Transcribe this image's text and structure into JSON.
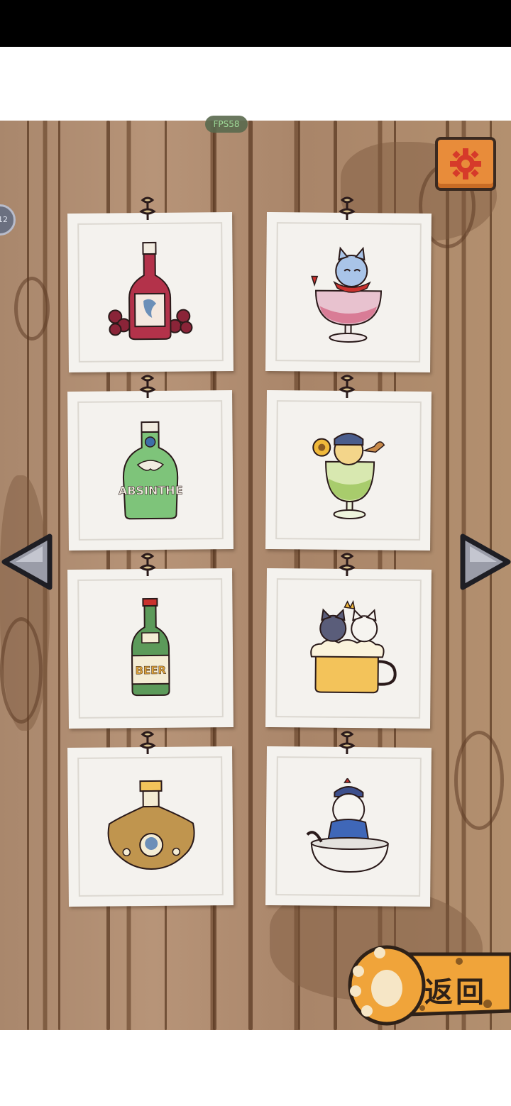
{
  "hud": {
    "fps_label": "FPS58",
    "side_badge": "12"
  },
  "settings": {
    "icon": "gear-icon",
    "accent": "#e88c3a"
  },
  "collection": {
    "items": [
      {
        "name": "red-wine-bottle",
        "icon": "wine-bottle-icon"
      },
      {
        "name": "cat-in-wine-glass",
        "icon": "wine-glass-cat-icon"
      },
      {
        "name": "absinthe-bottle",
        "icon": "absinthe-bottle-icon",
        "label": "ABSINTHE"
      },
      {
        "name": "cat-in-absinthe-glass",
        "icon": "absinthe-glass-cat-icon"
      },
      {
        "name": "beer-bottle",
        "icon": "beer-bottle-icon",
        "label": "BEER"
      },
      {
        "name": "cats-in-beer-mug",
        "icon": "beer-mug-cats-icon"
      },
      {
        "name": "baijiu-flask",
        "icon": "flask-icon"
      },
      {
        "name": "cat-in-bowl",
        "icon": "bowl-cat-icon"
      }
    ]
  },
  "nav": {
    "prev_icon": "arrow-left-icon",
    "next_icon": "arrow-right-icon"
  },
  "back_button": {
    "label": "返回",
    "icon": "cat-paw-icon"
  }
}
